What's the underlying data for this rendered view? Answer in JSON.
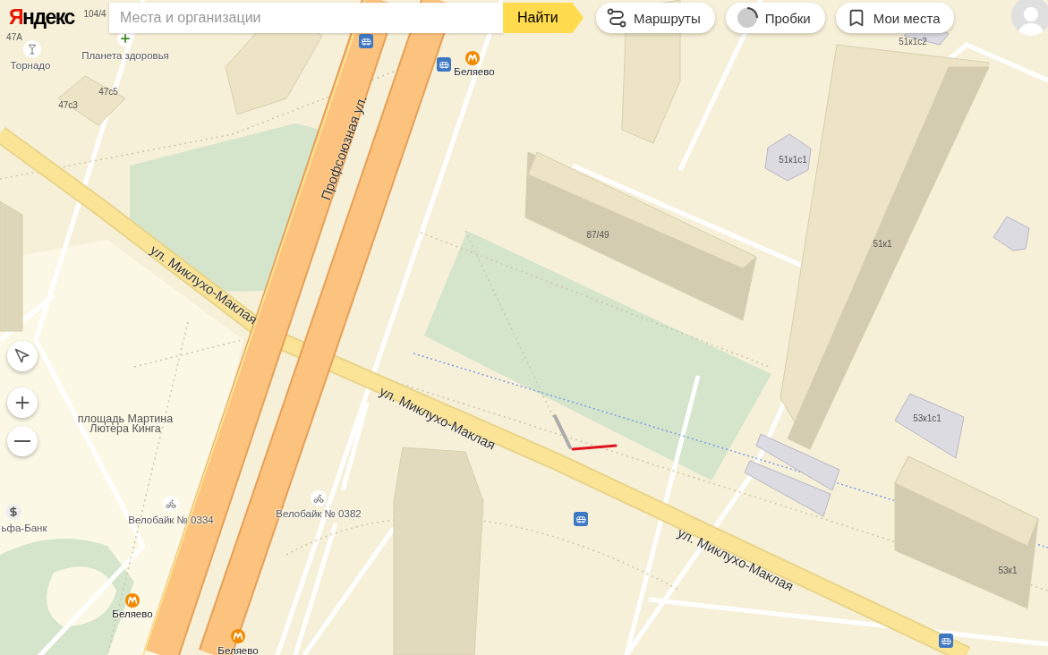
{
  "header": {
    "logo": "Яндекс",
    "search": {
      "placeholder": "Места и организации"
    },
    "search_button": "Найти",
    "buttons": [
      {
        "kind": "routes",
        "label": "Маршруты"
      },
      {
        "kind": "traffic",
        "label": "Пробки"
      },
      {
        "kind": "bookmarks",
        "label": "Мои места"
      }
    ]
  },
  "map": {
    "houses": [
      "104/4",
      "47А",
      "47с5",
      "47с3",
      "87/49",
      "51к1с1",
      "51к1",
      "53к1с1",
      "53к1",
      "51к1с2"
    ],
    "streets": [
      "Профсоюзная ул.",
      "ул. Миклухо-Маклая",
      "ул. Миклухо-Маклая",
      "ул. Миклухо-Маклая"
    ],
    "pois": [
      {
        "kind": "bar",
        "label": "Торнадо"
      },
      {
        "kind": "pharmacy",
        "label": "Планета здоровья"
      },
      {
        "kind": "metro",
        "label": "Беляево"
      },
      {
        "kind": "bike",
        "label": "Велобайк № 0334"
      },
      {
        "kind": "bike",
        "label": "Велобайк № 0382"
      },
      {
        "kind": "metro",
        "label": "Беляево"
      },
      {
        "kind": "metro",
        "label": "Беляево"
      },
      {
        "kind": "bank",
        "label": "ьфа-Банк"
      }
    ],
    "area_label": "площадь Мартина Лютера Кинга"
  }
}
